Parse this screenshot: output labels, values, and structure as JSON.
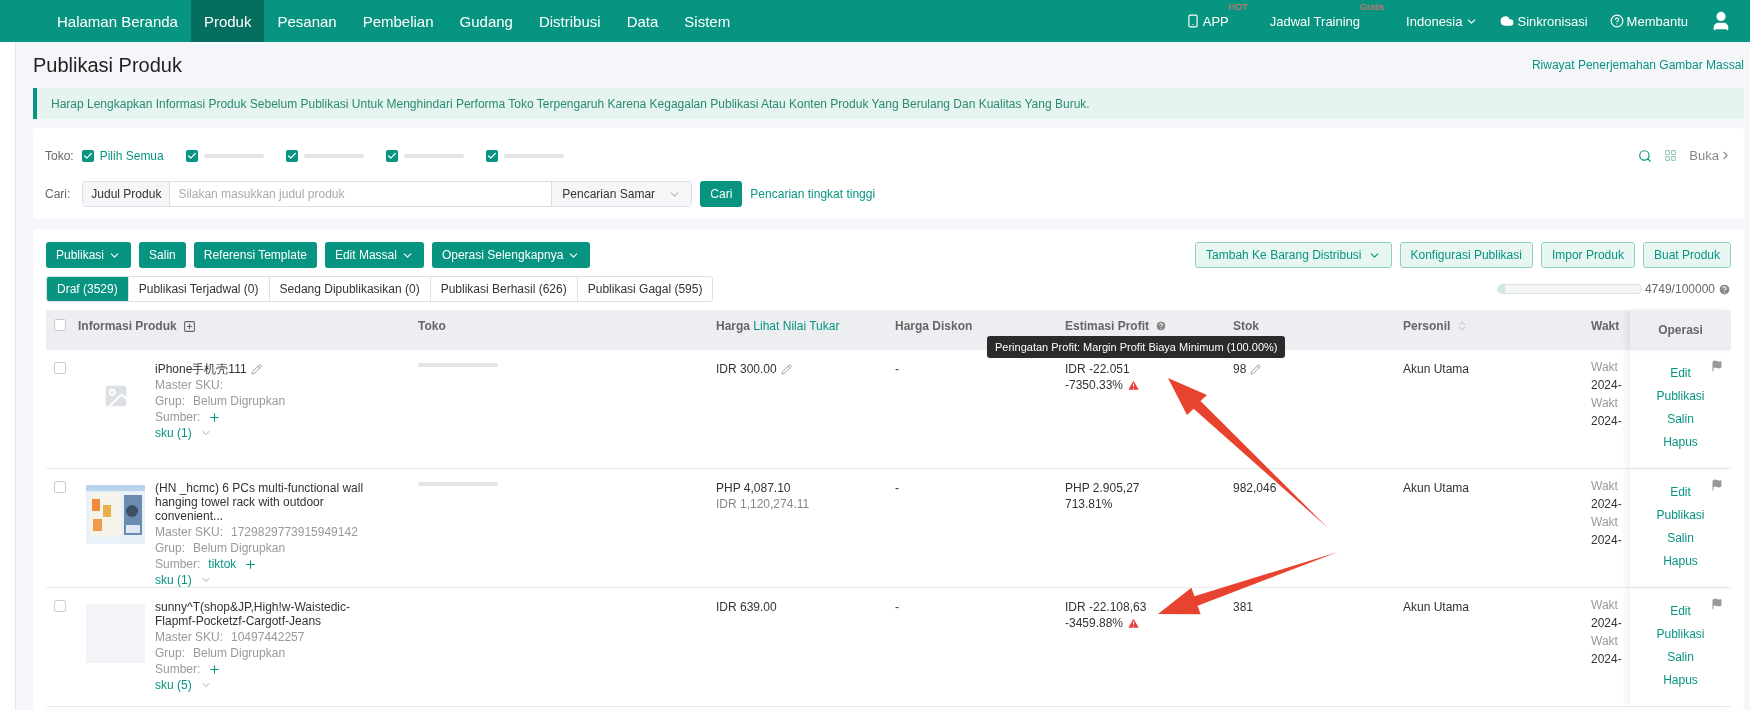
{
  "nav": {
    "items": [
      {
        "label": "Halaman Beranda",
        "selected": false
      },
      {
        "label": "Produk",
        "selected": true
      },
      {
        "label": "Pesanan",
        "selected": false
      },
      {
        "label": "Pembelian",
        "selected": false
      },
      {
        "label": "Gudang",
        "selected": false
      },
      {
        "label": "Distribusi",
        "selected": false
      },
      {
        "label": "Data",
        "selected": false
      },
      {
        "label": "Sistem",
        "selected": false
      }
    ],
    "right": [
      {
        "kind": "app",
        "label": "APP",
        "badge": "HOT"
      },
      {
        "kind": "training",
        "label": "Jadwal Training",
        "badge": "Gratis"
      },
      {
        "kind": "language",
        "label": "Indonesia"
      },
      {
        "kind": "sync",
        "label": "Sinkronisasi"
      },
      {
        "kind": "help",
        "label": "Membantu"
      },
      {
        "kind": "user"
      }
    ]
  },
  "page": {
    "title": "Publikasi Produk",
    "link": "Riwayat Penerjemahan Gambar Massal"
  },
  "alert": "Harap Lengkapkan Informasi Produk Sebelum Publikasi Untuk Menghindari Performa Toko Terpengaruh Karena Kegagalan Publikasi Atau Konten Produk Yang Berulang Dan Kualitas Yang Buruk.",
  "filter": {
    "shop_label": "Toko:",
    "shops": [
      {
        "kind": "all",
        "label": "Pilih Semua",
        "checked": true
      },
      {
        "kind": "redacted",
        "checked": true
      },
      {
        "kind": "redacted",
        "checked": true
      },
      {
        "kind": "redacted",
        "checked": true
      },
      {
        "kind": "redacted",
        "checked": true
      }
    ],
    "search_label": "Cari:",
    "field": "Judul Produk",
    "placeholder": "Silakan masukkan judul produk",
    "mode": "Pencarian Samar",
    "search_button": "Cari",
    "advanced_link": "Pencarian tingkat tinggi",
    "expand": "Buka"
  },
  "toolbar": {
    "left": [
      {
        "label": "Publikasi",
        "dropdown": true
      },
      {
        "label": "Salin",
        "dropdown": false
      },
      {
        "label": "Referensi Template",
        "dropdown": false
      },
      {
        "label": "Edit Massal",
        "dropdown": true
      },
      {
        "label": "Operasi Selengkapnya",
        "dropdown": true
      }
    ],
    "right": [
      {
        "label": "Tambah Ke Barang Distribusi",
        "dropdown": true
      },
      {
        "label": "Konfigurasi Publikasi",
        "dropdown": false
      },
      {
        "label": "Impor Produk",
        "dropdown": false
      },
      {
        "label": "Buat Produk",
        "dropdown": false
      }
    ]
  },
  "tabs": [
    {
      "label": "Draf (3529)",
      "selected": true
    },
    {
      "label": "Publikasi Terjadwal (0)",
      "selected": false
    },
    {
      "label": "Sedang Dipublikasikan (0)",
      "selected": false
    },
    {
      "label": "Publikasi Berhasil (626)",
      "selected": false
    },
    {
      "label": "Publikasi Gagal (595)",
      "selected": false
    }
  ],
  "quota": {
    "level": 0.047,
    "text": "4749/100000"
  },
  "table": {
    "select_all": {
      "checked": false
    },
    "columns": [
      {
        "label": "Informasi Produk"
      },
      {
        "label": "Toko"
      },
      {
        "label": "Harga",
        "link": "Lihat Nilai Tukar"
      },
      {
        "label": "Harga Diskon"
      },
      {
        "label": "Estimasi Profit"
      },
      {
        "label": "Stok"
      },
      {
        "label": "Personil"
      },
      {
        "label": "Wakt"
      },
      {
        "label": "Operasi"
      }
    ],
    "rows": [
      {
        "checked": false,
        "thumbnail": {
          "kind": "placeholder"
        },
        "title": "iPhone手机壳111",
        "title_edit": true,
        "sku_label": "Master SKU:",
        "group_label": "Grup:",
        "group": "Belum Digrupkan",
        "source_label": "Sumber:",
        "variants": "sku (1)",
        "shop_redacted": true,
        "prices": [
          "IDR 300.00"
        ],
        "price_edit": true,
        "discount": "-",
        "profit": [
          "IDR -22.051",
          "-7350.33%"
        ],
        "warning": true,
        "tooltip": "Peringatan Profit: Margin Profit Biaya Minimum (100.00%)",
        "stock": "98",
        "stock_edit": true,
        "personnel": "Akun Utama",
        "time": [
          "Wakt",
          "2024-",
          "Wakt",
          "2024-"
        ],
        "actions": [
          "Edit",
          "Publikasi",
          "Salin",
          "Hapus"
        ]
      },
      {
        "checked": false,
        "thumbnail": {
          "kind": "picture"
        },
        "title": "(HN _hcmc) 6 PCs multi-functional wall hanging towel rack with outdoor convenient...",
        "title_edit": false,
        "sku_label": "Master SKU:",
        "sku": "1729829773915949142",
        "group_label": "Grup:",
        "group": "Belum Digrupkan",
        "source_label": "Sumber:",
        "source": "tiktok",
        "variants": "sku (1)",
        "shop_redacted": true,
        "prices": [
          "PHP 4,087.10",
          "IDR 1,120,274.11"
        ],
        "price_edit": false,
        "discount": "-",
        "profit": [
          "PHP 2.905,27",
          "713.81%"
        ],
        "warning": false,
        "stock": "982,046",
        "stock_edit": false,
        "personnel": "Akun Utama",
        "time": [
          "Wakt",
          "2024-",
          "Wakt",
          "2024-"
        ],
        "actions": [
          "Edit",
          "Publikasi",
          "Salin",
          "Hapus"
        ]
      },
      {
        "checked": false,
        "thumbnail": {
          "kind": "blank"
        },
        "title": "sunny^T(shop&JP,High!w-Waistedic-Flapmf-Pocketzf-Cargotf-Jeans",
        "title_edit": false,
        "sku_label": "Master SKU:",
        "sku": "10497442257",
        "group_label": "Grup:",
        "group": "Belum Digrupkan",
        "source_label": "Sumber:",
        "variants": "sku (5)",
        "shop_redacted": false,
        "prices": [
          "IDR 639.00"
        ],
        "price_edit": false,
        "discount": "-",
        "profit": [
          "IDR -22.108,63",
          "-3459.88%"
        ],
        "warning": true,
        "stock": "381",
        "stock_edit": false,
        "personnel": "Akun Utama",
        "time": [
          "Wakt",
          "2024-",
          "Wakt",
          "2024-"
        ],
        "actions": [
          "Edit",
          "Publikasi",
          "Salin",
          "Hapus"
        ]
      }
    ]
  }
}
